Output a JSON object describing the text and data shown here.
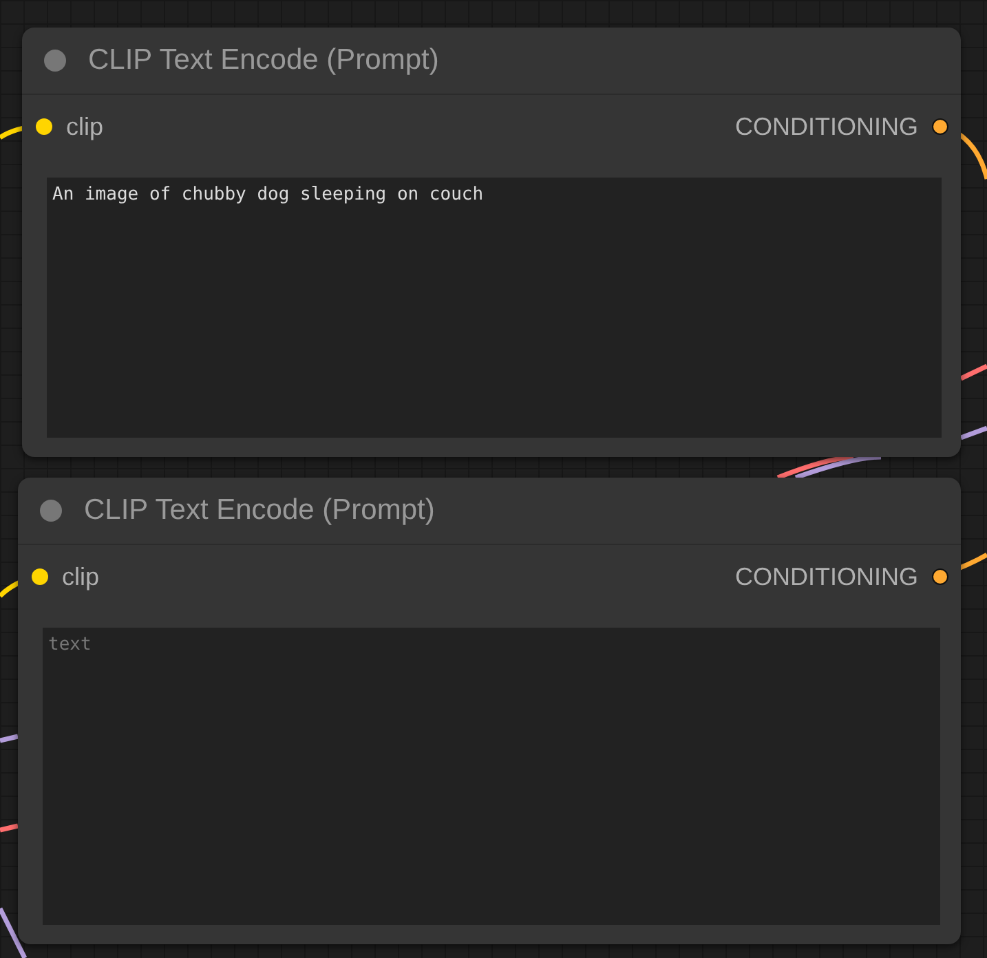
{
  "nodes": [
    {
      "title": "CLIP Text Encode (Prompt)",
      "inputs": [
        {
          "label": "clip",
          "color": "#ffd500"
        }
      ],
      "outputs": [
        {
          "label": "CONDITIONING",
          "color": "#ffa931"
        }
      ],
      "text": {
        "value": "An image of chubby dog sleeping on couch"
      }
    },
    {
      "title": "CLIP Text Encode (Prompt)",
      "inputs": [
        {
          "label": "clip",
          "color": "#ffd500"
        }
      ],
      "outputs": [
        {
          "label": "CONDITIONING",
          "color": "#ffa931"
        }
      ],
      "text": {
        "placeholder": "text"
      }
    }
  ]
}
